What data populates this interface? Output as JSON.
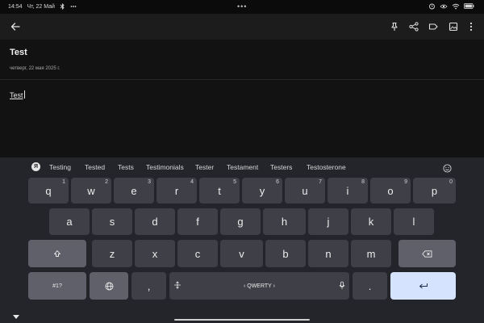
{
  "status_bar": {
    "time": "14:54",
    "date": "Чт, 22 Май",
    "overflow": "•••",
    "icons": [
      "bluetooth-icon",
      "more-dots-icon",
      "alarm-icon",
      "eye-icon",
      "wifi-icon",
      "battery-icon"
    ]
  },
  "toolbar": {
    "icons": [
      "back-arrow-icon",
      "pin-icon",
      "share-icon",
      "label-icon",
      "image-icon",
      "more-vert-icon"
    ]
  },
  "note": {
    "title": "Test",
    "date": "четверг, 22 мая 2025 г.",
    "body": "Test"
  },
  "keyboard": {
    "suggestions": [
      "Testing",
      "Tested",
      "Tests",
      "Testimonials",
      "Tester",
      "Testament",
      "Testers",
      "Testosterone"
    ],
    "row1": [
      {
        "label": "q",
        "hint": "1"
      },
      {
        "label": "w",
        "hint": "2"
      },
      {
        "label": "e",
        "hint": "3"
      },
      {
        "label": "r",
        "hint": "4"
      },
      {
        "label": "t",
        "hint": "5"
      },
      {
        "label": "y",
        "hint": "6"
      },
      {
        "label": "u",
        "hint": "7"
      },
      {
        "label": "i",
        "hint": "8"
      },
      {
        "label": "o",
        "hint": "9"
      },
      {
        "label": "p",
        "hint": "0"
      }
    ],
    "row2": [
      "a",
      "s",
      "d",
      "f",
      "g",
      "h",
      "j",
      "k",
      "l"
    ],
    "row3": [
      "z",
      "x",
      "c",
      "v",
      "b",
      "n",
      "m"
    ],
    "symbols_label": "#1?",
    "comma": ",",
    "space_label": "‹ QWERTY ›",
    "period": ".",
    "accent_color": "#d5e3ff"
  }
}
